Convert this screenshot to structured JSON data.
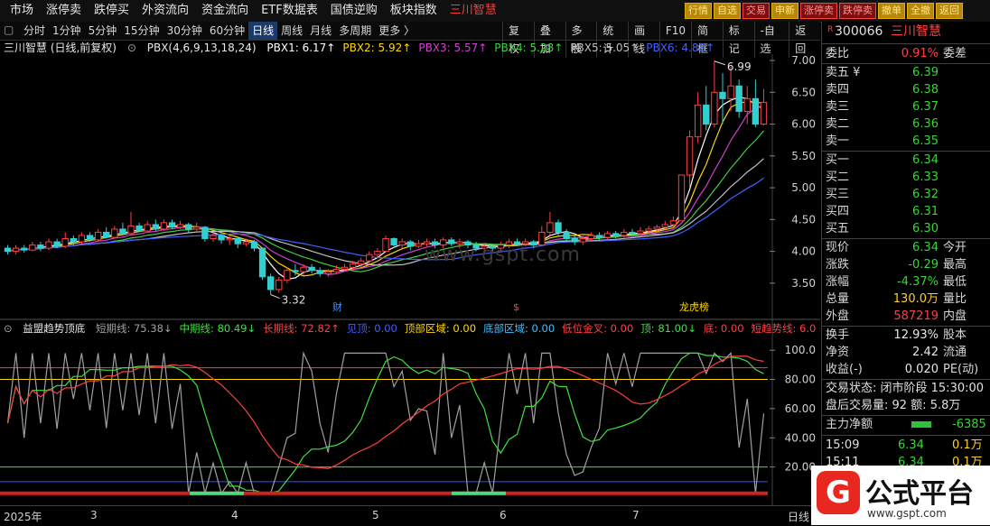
{
  "top_menu": [
    {
      "label": "市场"
    },
    {
      "label": "涨停卖"
    },
    {
      "label": "跌停买"
    },
    {
      "label": "外资流向"
    },
    {
      "label": "资金流向"
    },
    {
      "label": "ETF数据表"
    },
    {
      "label": "国债逆购"
    },
    {
      "label": "板块指数"
    },
    {
      "label": "三川智慧",
      "highlight": true
    }
  ],
  "top_buttons": [
    "行情",
    "自选",
    "交易",
    "申新",
    "涨停卖",
    "跌停卖",
    "撤单",
    "全撤",
    "返回"
  ],
  "periods": [
    "分时",
    "1分钟",
    "5分钟",
    "15分钟",
    "30分钟",
    "60分钟",
    "日线",
    "周线",
    "月线",
    "多周期",
    "更多 〉"
  ],
  "active_period": "日线",
  "tools": [
    "复权",
    "叠加",
    "多股",
    "统计",
    "画线",
    "F10",
    "简框",
    "标记",
    "-自选",
    "返回"
  ],
  "main_legend": {
    "title": "三川智慧 (日线,前复权)",
    "indicator": "PBX(4,6,9,13,18,24)",
    "items": [
      {
        "label": "PBX1: 6.17↑",
        "color": "#ffffff"
      },
      {
        "label": "PBX2: 5.92↑",
        "color": "#ffd700"
      },
      {
        "label": "PBX3: 5.57↑",
        "color": "#d040d0"
      },
      {
        "label": "PBX4: 5.28↑",
        "color": "#40d040"
      },
      {
        "label": "PBX5: 5.05↑",
        "color": "#c0c0c0"
      },
      {
        "label": "PBX6: 4.88↑",
        "color": "#4060ff"
      }
    ]
  },
  "sub_legend": {
    "title": "益盟趋势顶底",
    "items": [
      {
        "label": "短期线: 75.38↓",
        "color": "#a0a0a0"
      },
      {
        "label": "中期线: 80.49↓",
        "color": "#40e040"
      },
      {
        "label": "长期线: 72.82↑",
        "color": "#ff4040"
      },
      {
        "label": "见顶: 0.00",
        "color": "#4060ff"
      },
      {
        "label": "顶部区域: 0.00",
        "color": "#ffd700"
      },
      {
        "label": "底部区域: 0.00",
        "color": "#40c0ff"
      },
      {
        "label": "低位金叉: 0.00",
        "color": "#ff4040"
      },
      {
        "label": "顶: 81.00↓",
        "color": "#40e040"
      },
      {
        "label": "底: 0.00",
        "color": "#ff4040"
      },
      {
        "label": "短趋势线: 6.0",
        "color": "#ff4040"
      }
    ]
  },
  "price_axis": [
    "7.00",
    "6.50",
    "6.00",
    "5.50",
    "5.00",
    "4.50",
    "4.00",
    "3.50"
  ],
  "osc_axis": [
    "100.0",
    "80.00",
    "60.00",
    "40.00",
    "20.00"
  ],
  "annotations": {
    "high": "6.99",
    "low": "3.32",
    "marker1": "财",
    "marker2": "$",
    "marker3": "龙虎榜"
  },
  "x_axis": [
    "2025年",
    "3",
    "4",
    "5",
    "6",
    "7"
  ],
  "x_axis_right": "日线",
  "quote": {
    "code": "300066",
    "name": "三川智慧",
    "badge": "R",
    "weibi_label": "委比",
    "weibi_value": "0.91%",
    "weicha_label": "委差",
    "asks": [
      {
        "label": "卖五",
        "mark": "¥",
        "price": "6.39"
      },
      {
        "label": "卖四",
        "mark": "",
        "price": "6.38"
      },
      {
        "label": "卖三",
        "mark": "",
        "price": "6.37"
      },
      {
        "label": "卖二",
        "mark": "",
        "price": "6.36"
      },
      {
        "label": "卖一",
        "mark": "",
        "price": "6.35"
      }
    ],
    "bids": [
      {
        "label": "买一",
        "price": "6.34"
      },
      {
        "label": "买二",
        "price": "6.33"
      },
      {
        "label": "买三",
        "price": "6.32"
      },
      {
        "label": "买四",
        "price": "6.31"
      },
      {
        "label": "买五",
        "price": "6.30"
      }
    ],
    "stats": [
      {
        "label": "现价",
        "value": "6.34",
        "right": "今开",
        "color": "green"
      },
      {
        "label": "涨跌",
        "value": "-0.29",
        "right": "最高",
        "color": "green"
      },
      {
        "label": "涨幅",
        "value": "-4.37%",
        "right": "最低",
        "color": "green"
      },
      {
        "label": "总量",
        "value": "130.0万",
        "right": "量比",
        "color": "yellow"
      },
      {
        "label": "外盘",
        "value": "587219",
        "right": "内盘",
        "color": "red"
      }
    ],
    "stats2": [
      {
        "label": "换手",
        "value": "12.93%",
        "right": "股本",
        "color": "white"
      },
      {
        "label": "净资",
        "value": "2.42",
        "right": "流通",
        "color": "white"
      },
      {
        "label": "收益(-)",
        "value": "0.020",
        "right": "PE(动)",
        "color": "white"
      }
    ],
    "trade_status": "交易状态: 闭市阶段 15:30:00",
    "after_hours": "盘后交易量: 92  额: 5.8万",
    "main_flow_label": "主力净额",
    "main_flow_value": "-6385",
    "ticks": [
      {
        "time": "15:09",
        "price": "6.34",
        "vol": "0.1万"
      },
      {
        "time": "15:11",
        "price": "6.34",
        "vol": "0.1万"
      }
    ]
  },
  "watermark": {
    "icon": "G",
    "text": "公式平台",
    "url": "www.gspt.com",
    "center": "www.gspt.com"
  },
  "colors": {
    "up": "#ff4040",
    "down": "#30d0d0",
    "bg": "#000000"
  },
  "chart_data": {
    "type": "candlestick",
    "ylim": [
      3.2,
      7.1
    ],
    "candles": [
      [
        4.05,
        4.0,
        4.1,
        3.95
      ],
      [
        4.0,
        4.05,
        4.1,
        3.95
      ],
      [
        4.05,
        4.02,
        4.1,
        3.98
      ],
      [
        4.02,
        4.1,
        4.15,
        4.0
      ],
      [
        4.1,
        4.05,
        4.15,
        4.0
      ],
      [
        4.05,
        4.15,
        4.2,
        4.02
      ],
      [
        4.15,
        4.08,
        4.2,
        4.05
      ],
      [
        4.08,
        4.2,
        4.3,
        4.05
      ],
      [
        4.2,
        4.15,
        4.25,
        4.1
      ],
      [
        4.15,
        4.25,
        4.3,
        4.12
      ],
      [
        4.25,
        4.18,
        4.3,
        4.15
      ],
      [
        4.18,
        4.3,
        4.35,
        4.15
      ],
      [
        4.3,
        4.22,
        4.38,
        4.2
      ],
      [
        4.22,
        4.35,
        4.4,
        4.2
      ],
      [
        4.35,
        4.28,
        4.45,
        4.25
      ],
      [
        4.28,
        4.4,
        4.62,
        4.25
      ],
      [
        4.4,
        4.32,
        4.45,
        4.3
      ],
      [
        4.32,
        4.42,
        4.48,
        4.3
      ],
      [
        4.42,
        4.35,
        4.5,
        4.32
      ],
      [
        4.35,
        4.45,
        4.5,
        4.32
      ],
      [
        4.45,
        4.38,
        4.5,
        4.35
      ],
      [
        4.38,
        4.42,
        4.48,
        4.35
      ],
      [
        4.42,
        4.35,
        4.45,
        4.3
      ],
      [
        4.35,
        4.38,
        4.45,
        4.3
      ],
      [
        4.38,
        4.2,
        4.4,
        4.15
      ],
      [
        4.2,
        4.25,
        4.3,
        4.15
      ],
      [
        4.25,
        4.18,
        4.3,
        4.12
      ],
      [
        4.18,
        4.2,
        4.25,
        4.1
      ],
      [
        4.2,
        4.12,
        4.22,
        4.05
      ],
      [
        4.12,
        4.15,
        4.2,
        4.08
      ],
      [
        4.15,
        4.05,
        4.18,
        4.0
      ],
      [
        4.05,
        3.6,
        4.05,
        3.55
      ],
      [
        3.6,
        3.4,
        3.65,
        3.32
      ],
      [
        3.4,
        3.55,
        3.6,
        3.35
      ],
      [
        3.55,
        3.7,
        3.75,
        3.5
      ],
      [
        3.7,
        3.68,
        3.8,
        3.62
      ],
      [
        3.68,
        3.75,
        3.8,
        3.62
      ],
      [
        3.75,
        3.7,
        3.8,
        3.65
      ],
      [
        3.7,
        3.65,
        3.75,
        3.6
      ],
      [
        3.65,
        3.68,
        3.72,
        3.6
      ],
      [
        3.68,
        3.72,
        3.78,
        3.65
      ],
      [
        3.72,
        3.75,
        3.8,
        3.68
      ],
      [
        3.75,
        3.8,
        3.85,
        3.7
      ],
      [
        3.8,
        3.85,
        3.9,
        3.75
      ],
      [
        3.85,
        3.95,
        4.0,
        3.8
      ],
      [
        3.95,
        4.0,
        4.05,
        3.9
      ],
      [
        4.0,
        4.2,
        4.25,
        3.98
      ],
      [
        4.2,
        4.1,
        4.22,
        4.05
      ],
      [
        4.1,
        4.15,
        4.2,
        4.05
      ],
      [
        4.15,
        4.08,
        4.18,
        4.02
      ],
      [
        4.08,
        4.12,
        4.18,
        4.05
      ],
      [
        4.12,
        4.15,
        4.2,
        4.08
      ],
      [
        4.15,
        4.1,
        4.2,
        4.05
      ],
      [
        4.1,
        4.18,
        4.22,
        4.05
      ],
      [
        4.18,
        4.12,
        4.22,
        4.08
      ],
      [
        4.12,
        4.15,
        4.2,
        4.05
      ],
      [
        4.15,
        4.1,
        4.18,
        4.05
      ],
      [
        4.1,
        4.05,
        4.15,
        4.0
      ],
      [
        4.05,
        4.08,
        4.12,
        4.0
      ],
      [
        4.08,
        4.05,
        4.12,
        4.0
      ],
      [
        4.05,
        4.1,
        4.15,
        4.02
      ],
      [
        4.1,
        4.15,
        4.2,
        4.05
      ],
      [
        4.15,
        4.12,
        4.2,
        4.08
      ],
      [
        4.12,
        4.15,
        4.2,
        4.08
      ],
      [
        4.15,
        4.1,
        4.18,
        4.05
      ],
      [
        4.1,
        4.3,
        4.4,
        4.08
      ],
      [
        4.3,
        4.45,
        4.62,
        4.25
      ],
      [
        4.45,
        4.3,
        4.5,
        4.25
      ],
      [
        4.3,
        4.2,
        4.35,
        4.15
      ],
      [
        4.2,
        4.15,
        4.25,
        4.1
      ],
      [
        4.15,
        4.2,
        4.25,
        4.1
      ],
      [
        4.2,
        4.25,
        4.3,
        4.15
      ],
      [
        4.25,
        4.22,
        4.3,
        4.18
      ],
      [
        4.22,
        4.28,
        4.32,
        4.18
      ],
      [
        4.28,
        4.25,
        4.32,
        4.2
      ],
      [
        4.25,
        4.3,
        4.35,
        4.22
      ],
      [
        4.3,
        4.28,
        4.35,
        4.25
      ],
      [
        4.28,
        4.32,
        4.38,
        4.25
      ],
      [
        4.32,
        4.35,
        4.4,
        4.28
      ],
      [
        4.35,
        4.38,
        4.42,
        4.3
      ],
      [
        4.38,
        4.42,
        4.48,
        4.35
      ],
      [
        4.42,
        4.48,
        4.55,
        4.4
      ],
      [
        4.48,
        5.2,
        5.2,
        4.48
      ],
      [
        5.2,
        5.8,
        5.9,
        5.0
      ],
      [
        5.8,
        6.3,
        6.5,
        5.7
      ],
      [
        6.3,
        6.0,
        6.6,
        5.9
      ],
      [
        6.0,
        6.5,
        6.99,
        5.95
      ],
      [
        6.5,
        6.4,
        6.8,
        6.0
      ],
      [
        6.4,
        6.6,
        6.9,
        6.2
      ],
      [
        6.6,
        6.2,
        6.7,
        6.1
      ],
      [
        6.2,
        6.4,
        6.6,
        6.0
      ],
      [
        6.4,
        6.0,
        6.7,
        5.95
      ],
      [
        6.0,
        6.34,
        6.55,
        5.98
      ]
    ]
  }
}
